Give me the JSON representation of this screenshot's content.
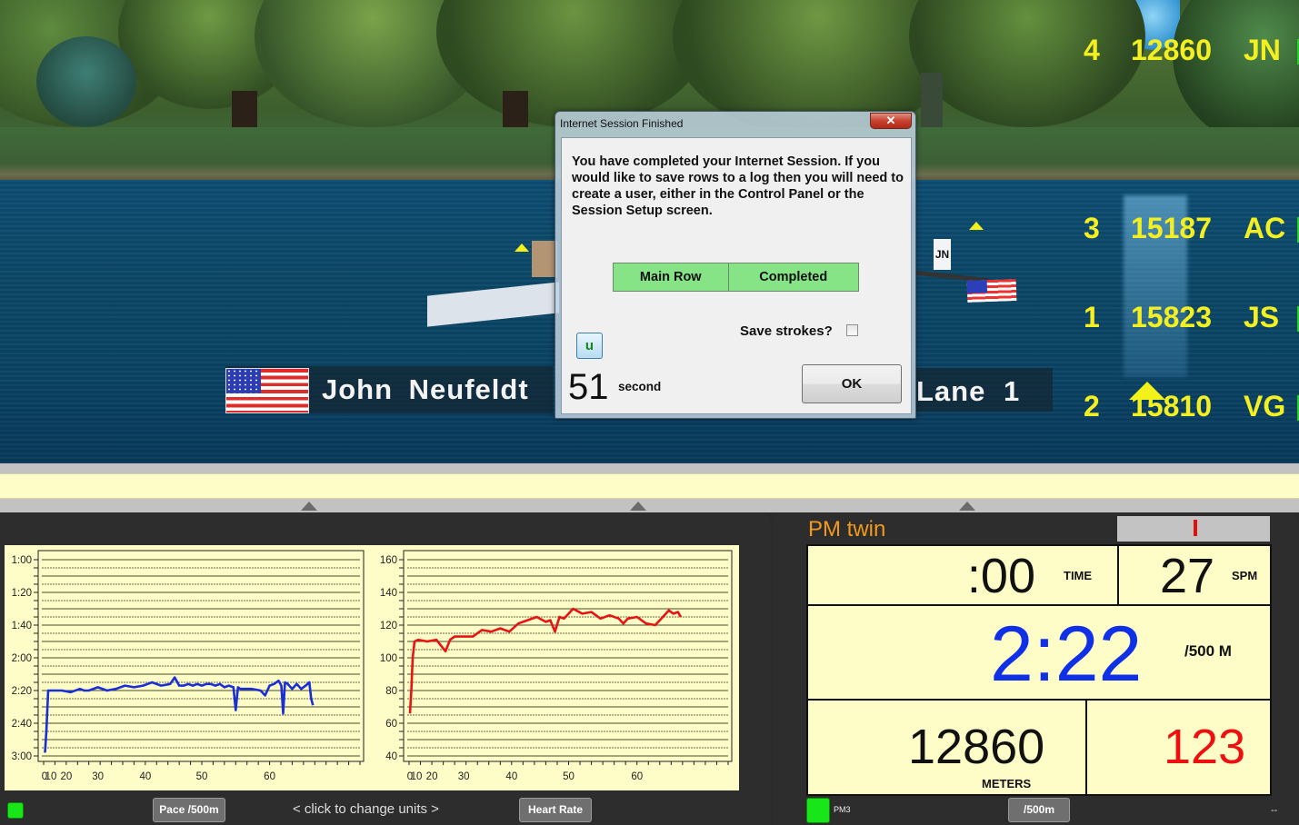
{
  "scene": {
    "rower_name": "John  Neufeldt",
    "lane_label": "Lane  1",
    "boat_tag": "JN",
    "standings": [
      {
        "place": "4",
        "meters": "12860",
        "initials": "JN"
      },
      {
        "place": "3",
        "meters": "15187",
        "initials": "AC"
      },
      {
        "place": "1",
        "meters": "15823",
        "initials": "JS"
      },
      {
        "place": "2",
        "meters": "15810",
        "initials": "VG"
      }
    ]
  },
  "dialog": {
    "title": "Internet Session Finished",
    "close_glyph": "✕",
    "message": "You have completed your Internet Session.  If you would like to save rows to a log then you will need to create a user, either in the Control Panel or the Session Setup screen.",
    "status_table": {
      "name": "Main Row",
      "status": "Completed"
    },
    "save_strokes_label": "Save strokes?",
    "save_strokes_checked": false,
    "u_button_label": "u",
    "countdown_value": "51",
    "countdown_unit": "second",
    "ok_label": "OK"
  },
  "left_panel": {
    "pace_button_label": "Pace /500m",
    "change_units_label": "<  click to change units  >",
    "hr_button_label": "Heart Rate"
  },
  "right_panel": {
    "title": "PM twin",
    "time_value": ":00",
    "time_unit": "TIME",
    "spm_value": "27",
    "spm_unit": "SPM",
    "pace_value": "2:22",
    "pace_unit": "/500 M",
    "meters_value": "12860",
    "meters_unit": "METERS",
    "heart_rate_value": "123",
    "pm_label": "PM3",
    "units_button_label": "/500m",
    "dash_mark": "--",
    "colors": {
      "title": "#f29a1b",
      "pace": "#1030e8",
      "heart_rate": "#ee1010"
    }
  },
  "chart_data": [
    {
      "type": "line",
      "title": "Pace /500m",
      "xlabel": "",
      "ylabel": "",
      "y_inverted": true,
      "ylim_seconds": [
        60,
        180
      ],
      "ytick_labels": [
        "1:00",
        "1:20",
        "1:40",
        "2:00",
        "2:20",
        "2:40",
        "3:00"
      ],
      "ytick_values": [
        60,
        80,
        100,
        120,
        140,
        160,
        180
      ],
      "xtick_labels": [
        "0",
        "10",
        "20",
        "30",
        "40",
        "50",
        "60"
      ],
      "xlim": [
        0,
        70
      ],
      "x_axis_note": "ticks 0 and 10 are crowded near origin (\"010\")",
      "grid": true,
      "series": [
        {
          "name": "pace",
          "color": "#1a2fd8",
          "x": [
            0.3,
            0.6,
            1,
            2,
            4,
            6,
            8,
            9,
            10,
            12,
            14,
            16,
            18,
            20,
            22,
            24,
            26,
            28,
            29,
            30,
            31,
            32,
            33,
            34,
            35,
            36,
            37,
            38,
            39,
            40,
            41,
            42,
            42.5,
            43,
            43.5,
            44,
            46,
            48,
            49,
            50,
            51,
            52,
            52.6,
            53,
            53.4,
            54,
            55,
            56,
            57,
            58,
            58.8,
            59.2,
            59.6
          ],
          "values": [
            178,
            165,
            140,
            140,
            140,
            141,
            139,
            140,
            140,
            138,
            140,
            139,
            137,
            138,
            137,
            135,
            137,
            136,
            132,
            137,
            137,
            136,
            137,
            136,
            137,
            136,
            136,
            137,
            136,
            138,
            137,
            138,
            152,
            138,
            139,
            139,
            139,
            140,
            143,
            137,
            136,
            134,
            137,
            154,
            135,
            136,
            139,
            136,
            139,
            137,
            135,
            145,
            149
          ]
        }
      ]
    },
    {
      "type": "line",
      "title": "Heart Rate",
      "xlabel": "",
      "ylabel": "",
      "ylim": [
        40,
        160
      ],
      "ytick_labels": [
        "40",
        "60",
        "80",
        "100",
        "120",
        "140",
        "160"
      ],
      "xtick_labels": [
        "0",
        "10",
        "20",
        "30",
        "40",
        "50",
        "60"
      ],
      "xlim": [
        0,
        70
      ],
      "grid": true,
      "series": [
        {
          "name": "heart_rate",
          "color": "#e81414",
          "x": [
            0.2,
            0.5,
            0.8,
            1.2,
            2,
            4,
            6,
            8,
            9,
            10,
            12,
            14,
            16,
            18,
            20,
            22,
            24,
            26,
            28,
            30,
            31,
            32,
            33,
            34,
            36,
            38,
            40,
            42,
            44,
            46,
            47,
            48,
            50,
            52,
            54,
            55,
            56,
            57,
            58,
            59,
            59.6
          ],
          "values": [
            66,
            80,
            100,
            110,
            111,
            110,
            111,
            104,
            111,
            113,
            113,
            113,
            117,
            116,
            118,
            116,
            121,
            123,
            125,
            122,
            123,
            116,
            125,
            124,
            130,
            127,
            128,
            124,
            126,
            124,
            121,
            124,
            125,
            121,
            120,
            123,
            126,
            129,
            127,
            128,
            125
          ]
        }
      ]
    }
  ]
}
